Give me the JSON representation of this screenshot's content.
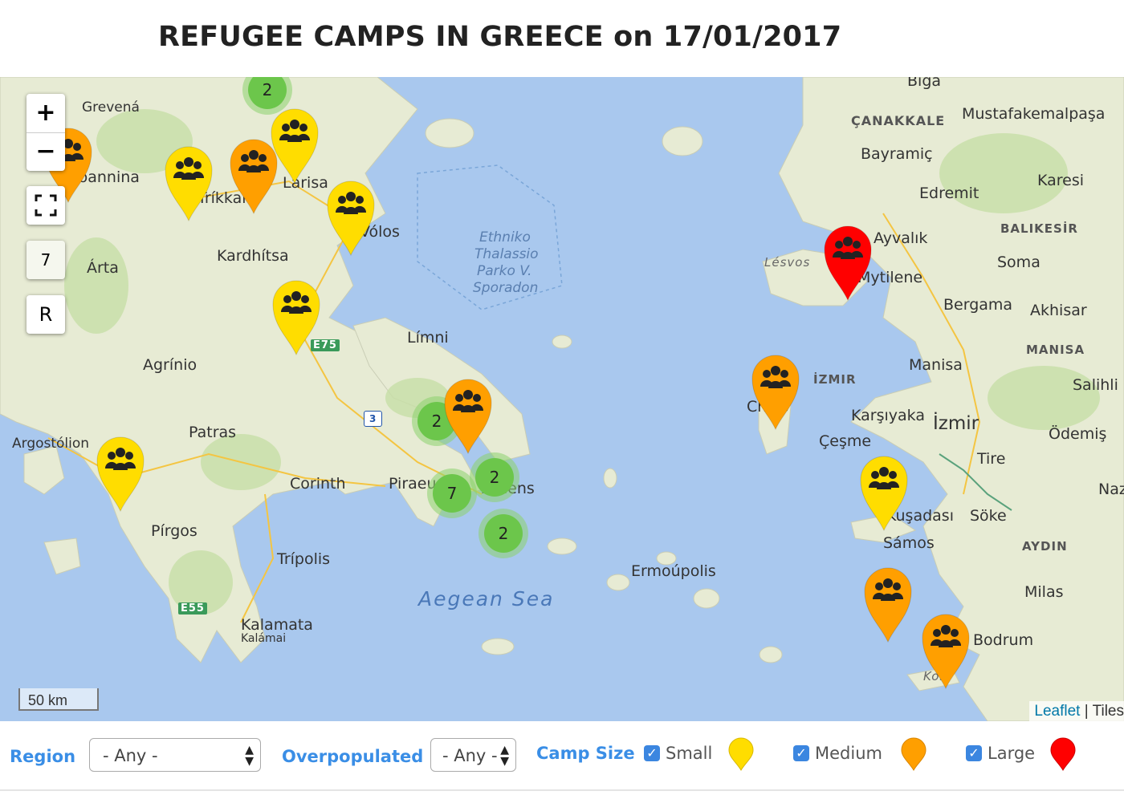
{
  "title": "REFUGEE CAMPS IN GREECE on 17/01/2017",
  "map": {
    "zoom_in_label": "+",
    "zoom_out_label": "−",
    "fullscreen_icon": "fullscreen-icon",
    "cluster_control_count": "7",
    "reset_label": "R",
    "scale_label": "50 km",
    "attribution_link": "Leaflet",
    "attribution_text": " | Tiles",
    "sea_label": "Aegean Sea",
    "park_label": [
      "Ethniko",
      "Thalassio",
      "Parko V.",
      "Sporadon"
    ],
    "place_labels": [
      "Biga",
      "ÇANAKKALE",
      "Mustafakemalpaşa",
      "Bayramiç",
      "Edremit",
      "Karesi",
      "BALIKESİR",
      "Ayvalık",
      "Lésvos",
      "Mytilene",
      "Soma",
      "Bergama",
      "Akhisar",
      "MANISA",
      "Manisa",
      "Salihli",
      "İZMIR",
      "Karşıyaka",
      "İzmir",
      "Çeşme",
      "Ödemiş",
      "Tire",
      "Kuşadası",
      "Söke",
      "Naz",
      "Sámos",
      "AYDIN",
      "Milas",
      "Bodrum",
      "Kos",
      "Grevená",
      "Ioannina",
      "Tríkkala",
      "Lárisa",
      "Vólos",
      "Kardhítsa",
      "Árta",
      "Límni",
      "Agrínio",
      "Patras",
      "Argostólion",
      "Corinth",
      "Piraeus",
      "Athens",
      "Pírgos",
      "Trípolis",
      "Kalamata",
      "Kalámai",
      "Ermoúpolis",
      "Chios",
      "E75",
      "E55",
      "3"
    ],
    "clusters": [
      "2",
      "2",
      "7",
      "2",
      "2"
    ],
    "camps": [
      {
        "size": "medium",
        "icon": "group-icon"
      },
      {
        "size": "small",
        "icon": "group-icon"
      },
      {
        "size": "medium",
        "icon": "group-icon"
      },
      {
        "size": "small",
        "icon": "group-icon"
      },
      {
        "size": "small",
        "icon": "group-icon"
      },
      {
        "size": "small",
        "icon": "group-icon"
      },
      {
        "size": "small",
        "icon": "group-icon"
      },
      {
        "size": "medium",
        "icon": "group-icon"
      },
      {
        "size": "small",
        "icon": "group-icon"
      },
      {
        "size": "large",
        "icon": "group-icon"
      },
      {
        "size": "medium",
        "icon": "group-icon"
      },
      {
        "size": "small",
        "icon": "group-icon"
      },
      {
        "size": "medium",
        "icon": "group-icon"
      },
      {
        "size": "medium",
        "icon": "group-icon"
      }
    ]
  },
  "filters": {
    "region_label": "Region",
    "region_value": "- Any -",
    "overpopulated_label": "Overpopulated",
    "overpopulated_value": "- Any -",
    "camp_size_label": "Camp Size",
    "sizes": [
      {
        "label": "Small",
        "checked": true,
        "color": "#ffdd00"
      },
      {
        "label": "Medium",
        "checked": true,
        "color": "#ff9f00"
      },
      {
        "label": "Large",
        "checked": true,
        "color": "#ff0000"
      }
    ]
  },
  "colors": {
    "small": "#ffdd00",
    "medium": "#ff9f00",
    "large": "#ff0000",
    "sea": "#a9c8ee",
    "land": "#e7ebd4",
    "cluster": "#6cc64b",
    "accent": "#3a8ee6"
  }
}
